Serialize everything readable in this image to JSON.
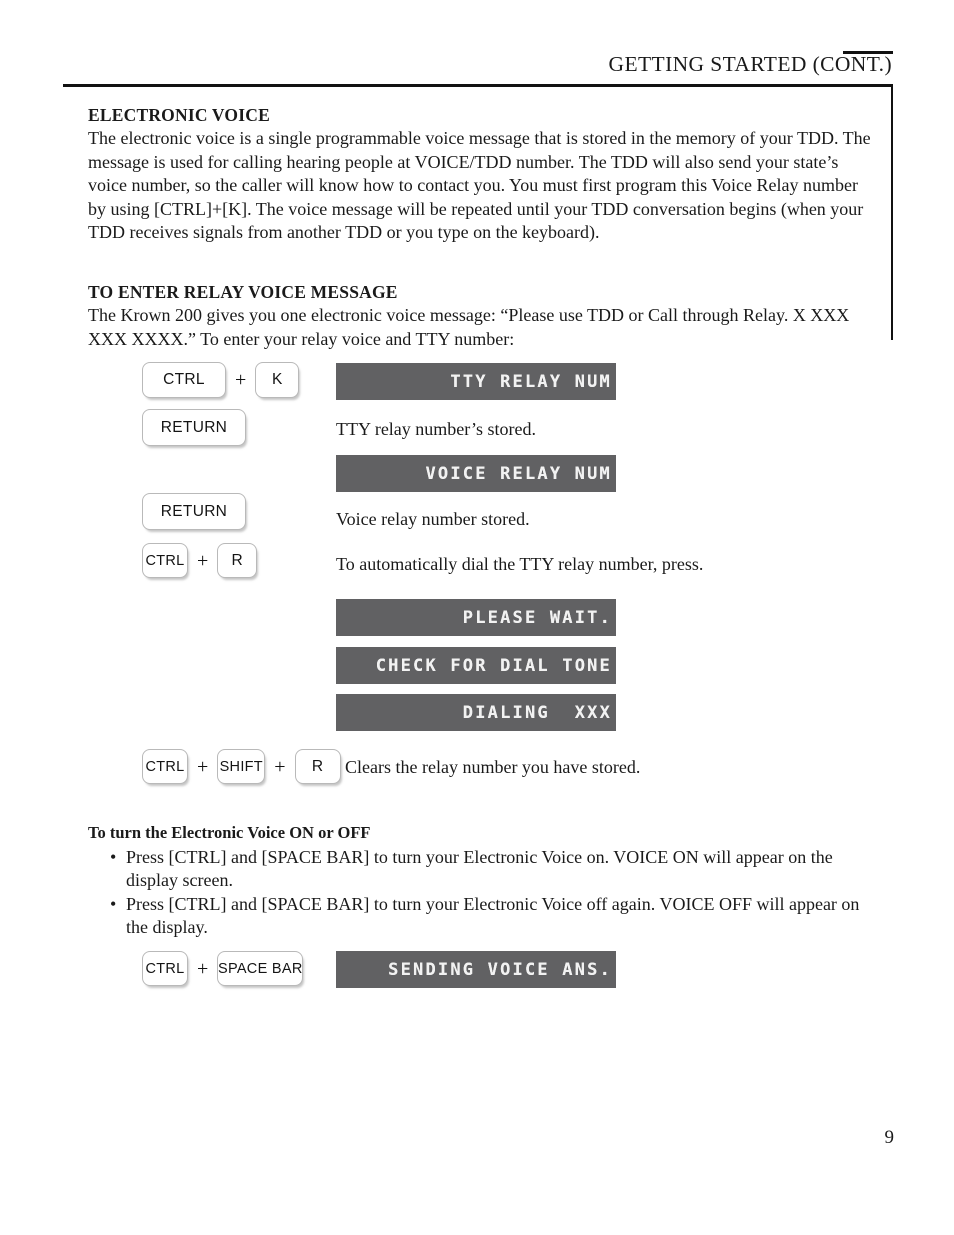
{
  "header": {
    "title": "GETTING STARTED (CONT.)"
  },
  "page": {
    "number": "9"
  },
  "sections": {
    "electronic_voice": {
      "heading": "ELECTRONIC VOICE",
      "paragraph": "The electronic voice is a single programmable voice message that is stored in the memory of your TDD. The message is used for calling hearing people at VOICE/TDD number. The TDD will also send your state’s voice number, so the caller will know how to contact you. You must first program this Voice Relay number by using [CTRL]+[K]. The voice message will be repeated until your TDD conversation begins (when your TDD receives signals from another TDD or you type on the keyboard)."
    },
    "relay_voice_message": {
      "heading": "TO ENTER RELAY VOICE MESSAGE",
      "paragraph": "The Krown 200 gives you one electronic voice message: “Please use TDD or Call through Relay. X XXX XXX XXXX.” To enter your relay voice and TTY number:"
    },
    "voice_on_off": {
      "heading": "To turn the Electronic Voice ON or OFF",
      "bullets": [
        "Press [CTRL] and [SPACE BAR] to turn your Electronic Voice on. VOICE ON will appear on the display screen.",
        "Press [CTRL] and [SPACE BAR] to turn your Electronic Voice off again. VOICE OFF will appear on the display."
      ],
      "bullet_marker": "•"
    }
  },
  "keys": {
    "ctrl": "CTRL",
    "k": "K",
    "r": "R",
    "shift": "SHIFT",
    "return": "RETURN",
    "space_bar": "SPACE BAR",
    "plus": "+"
  },
  "steps": [
    {
      "id": "step-ctrl-k",
      "keys": [
        "CTRL",
        "K"
      ],
      "lcd": "TTY RELAY NUM",
      "note": ""
    },
    {
      "id": "step-return-tty",
      "keys": [
        "RETURN"
      ],
      "lcd": "",
      "note": "TTY relay number’s stored."
    },
    {
      "id": "step-voice-relay-display",
      "keys": [],
      "lcd": "VOICE RELAY NUM",
      "note": ""
    },
    {
      "id": "step-return-voice",
      "keys": [
        "RETURN"
      ],
      "lcd": "",
      "note": "Voice relay number stored."
    },
    {
      "id": "step-ctrl-r",
      "keys": [
        "CTRL",
        "R"
      ],
      "lcd": "",
      "note": "To automatically dial the TTY relay number, press."
    },
    {
      "id": "step-please-wait",
      "keys": [],
      "lcd": "PLEASE WAIT.",
      "note": ""
    },
    {
      "id": "step-check-dial-tone",
      "keys": [],
      "lcd": "CHECK FOR DIAL TONE",
      "note": ""
    },
    {
      "id": "step-dialing",
      "keys": [],
      "lcd": "DIALING  XXX",
      "note": ""
    },
    {
      "id": "step-ctrl-shift-r",
      "keys": [
        "CTRL",
        "SHIFT",
        "R"
      ],
      "lcd": "",
      "note": "Clears the relay number you have stored."
    },
    {
      "id": "step-ctrl-space",
      "keys": [
        "CTRL",
        "SPACE BAR"
      ],
      "lcd": "SENDING VOICE ANS.",
      "note": ""
    }
  ],
  "lcd_messages": {
    "tty_relay_num": "TTY RELAY NUM",
    "voice_relay_num": "VOICE RELAY NUM",
    "please_wait": "PLEASE WAIT.",
    "check_for_dial_tone": "CHECK FOR DIAL TONE",
    "dialing_xxx": "DIALING  XXX",
    "sending_voice_ans": "SENDING VOICE ANS."
  },
  "notes": {
    "tty_stored": "TTY relay number’s stored.",
    "voice_stored": "Voice relay number stored.",
    "auto_dial": "To automatically dial the TTY relay number, press.",
    "clears_relay": "Clears the relay number you have stored."
  },
  "colors": {
    "lcd_background": "#616163",
    "lcd_text": "#f2f2f2",
    "rule": "#111111",
    "key_border": "#b9b9b9",
    "page_background": "#ffffff"
  }
}
